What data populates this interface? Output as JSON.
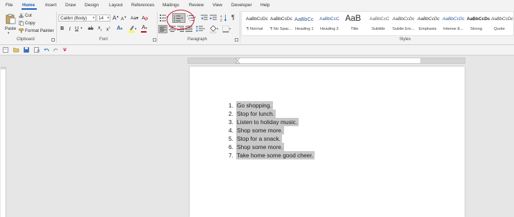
{
  "menu": {
    "tabs": [
      "File",
      "Home",
      "Insert",
      "Draw",
      "Design",
      "Layout",
      "References",
      "Mailings",
      "Review",
      "View",
      "Developer",
      "Help"
    ],
    "active": "Home"
  },
  "clipboard": {
    "paste_label": "Paste",
    "cut_label": "Cut",
    "copy_label": "Copy",
    "format_painter_label": "Format Painter",
    "group_label": "Clipboard"
  },
  "font": {
    "font_name": "Calibri (Body)",
    "font_size": "14",
    "grow": "A",
    "shrink": "A",
    "case": "Aa",
    "bold": "B",
    "italic": "I",
    "underline": "U",
    "strike": "ab",
    "subscript": "x",
    "superscript": "x",
    "highlight": "A",
    "color": "A",
    "group_label": "Font",
    "colors": {
      "highlight": "#ffff00",
      "font_color": "#d00000",
      "text_effects": "#2b6cc4"
    }
  },
  "paragraph": {
    "group_label": "Paragraph",
    "pilcrow": "¶"
  },
  "styles": {
    "group_label": "Styles",
    "items": [
      {
        "sample": "AaBbCcDc",
        "name": "¶ Normal"
      },
      {
        "sample": "AaBbCcDc",
        "name": "¶ No Spac..."
      },
      {
        "sample": "AaBbCc",
        "name": "Heading 1"
      },
      {
        "sample": "AaBbCcC",
        "name": "Heading 2"
      },
      {
        "sample": "AaB",
        "name": "Title"
      },
      {
        "sample": "AaBbCcC",
        "name": "Subtitle"
      },
      {
        "sample": "AaBbCcDc",
        "name": "Subtle Em..."
      },
      {
        "sample": "AaBbCcDc",
        "name": "Emphasis"
      },
      {
        "sample": "AaBbCcDc",
        "name": "Intense E..."
      },
      {
        "sample": "AaBbCcDc",
        "name": "Strong"
      },
      {
        "sample": "AaBbCcDc",
        "name": "Quote"
      }
    ]
  },
  "document": {
    "list": [
      {
        "num": "1.",
        "text": "Go shopping."
      },
      {
        "num": "2.",
        "text": "Stop for lunch."
      },
      {
        "num": "3.",
        "text": "Listen to holiday music."
      },
      {
        "num": "4.",
        "text": "Shop some more."
      },
      {
        "num": "5.",
        "text": "Stop for a snack."
      },
      {
        "num": "6.",
        "text": "Shop some more."
      },
      {
        "num": "7.",
        "text": "Take home some good cheer."
      }
    ]
  },
  "colors": {
    "accent": "#185abd",
    "annotation": "#c8102e",
    "selection": "#c9c9c9"
  }
}
